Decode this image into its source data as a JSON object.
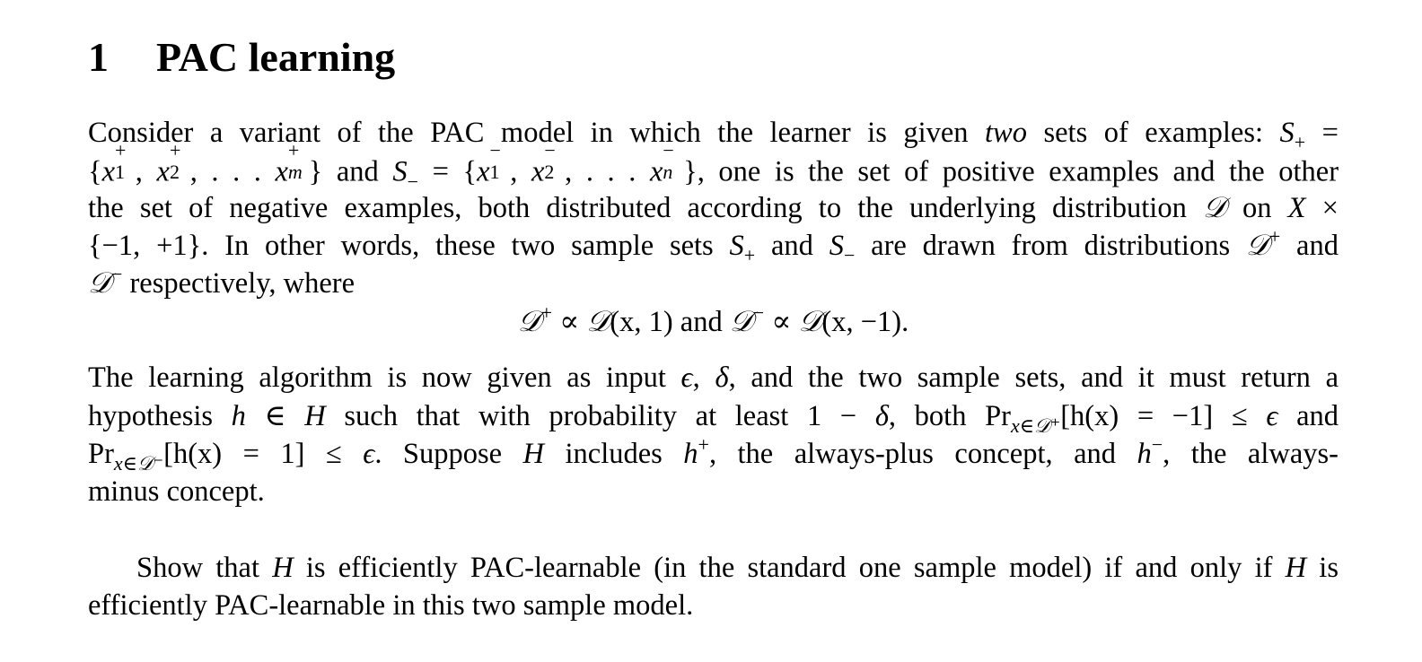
{
  "section": {
    "number": "1",
    "title": "PAC learning"
  },
  "paragraph1": {
    "lines": [
      "Consider a variant of the PAC model in which the learner is given two sets of examples: S₊ =",
      "{x₁⁺, x₂⁺, . . . , xₘ⁺} and S₋ = {x₁⁻, x₂⁻, . . . , xₙ⁻}, one is the set of positive examples and the other",
      "the set of negative examples, both distributed according to the underlying distribution 𝒟 on X ×",
      "{−1, +1}. In other words, these two sample sets S₊ and S₋ are drawn from distributions 𝒟⁺ and",
      "𝒟⁻ respectively, where"
    ]
  },
  "equation": "𝒟⁺ ∝ 𝒟(x, 1) and 𝒟⁻ ∝ 𝒟(x, −1).",
  "paragraph2": {
    "lines": [
      "The learning algorithm is now given as input ϵ, δ, and the two sample sets, and it must return a",
      "hypothesis h ∈ H such that with probability at least 1 − δ, both Pr_{x∈𝒟⁺}[h(x) = −1] ≤ ϵ and",
      "Pr_{x∈𝒟⁻}[h(x) = 1] ≤ ϵ. Suppose H includes h⁺, the always-plus concept, and h⁻, the always-",
      "minus concept."
    ]
  },
  "paragraph3": {
    "lines": [
      "Show that H is efficiently PAC-learnable (in the standard one sample model) if and only if H is",
      "efficiently PAC-learnable in this two sample model."
    ]
  },
  "t": {
    "p1l1a": "Consider a variant of the PAC model in which the learner is given ",
    "p1l1b": "two",
    "p1l1c": " sets of examples: ",
    "S": "S",
    "plus": "+",
    "minus": "−",
    "eq": " = ",
    "lbrace": "{",
    "rbrace": "}",
    "x": "x",
    "one": "1",
    "two": "2",
    "m": "m",
    "n": "n",
    "comma": ", ",
    "dots": ". . . ",
    "and": " and ",
    "p1l2c": ", one is the set of positive examples and the other",
    "p1l3a": "the set of negative examples, both distributed according to the underlying distribution ",
    "D": "𝒟",
    "p1l3b": " on ",
    "X": "X",
    "times": " ×",
    "p1l4a": "{−1, +1}. In other words, these two sample sets ",
    "p1l4b": " and ",
    "p1l4c": " are drawn from distributions ",
    "p1l4d": " and",
    "p1l5a": " respectively, where",
    "eq_prop": " ∝ ",
    "eq_arg1": "(x, 1)",
    "eq_arg2": "(x, −1).",
    "eq_and": " and ",
    "p2l1a": "The learning algorithm is now given as input ",
    "eps": "ϵ",
    "delta": "δ",
    "p2l1b": ", and the two sample sets, and it must return a",
    "p2l2a": "hypothesis ",
    "h": "h",
    "in": " ∈ ",
    "H": "H",
    "p2l2b": " such that with probability at least 1 − ",
    "p2l2c": ", both Pr",
    "sub_plus": "x∈𝒟⁺",
    "sub_minus": "x∈𝒟⁻",
    "p2l2d": "[h(x) = −1] ≤ ",
    "p2l2e": " and",
    "p2l3a": "Pr",
    "p2l3b": "[h(x) = 1] ≤ ",
    "p2l3c": ". Suppose ",
    "p2l3d": " includes ",
    "p2l3e": ", the always-plus concept, and ",
    "p2l3f": ", the always-",
    "p2l4": "minus concept.",
    "p3l1a": "Show that ",
    "p3l1b": " is efficiently PAC-learnable (in the standard one sample model) if and only if ",
    "p3l1c": " is",
    "p3l2": "efficiently PAC-learnable in this two sample model."
  }
}
